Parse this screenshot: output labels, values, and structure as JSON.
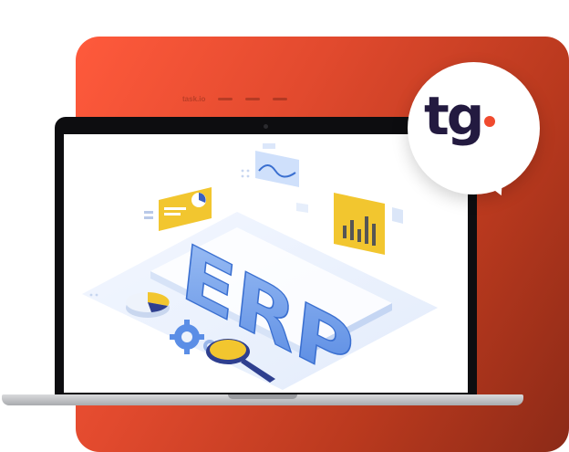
{
  "ghost_nav": {
    "brand": "task.io"
  },
  "logo": {
    "text": "tg",
    "dot_color": "#f04a2e",
    "text_color": "#231a40"
  },
  "illustration": {
    "word": "ERP"
  },
  "colors": {
    "panel": "#e24a2e",
    "accent_yellow": "#f2c62f",
    "accent_blue": "#5b8ee6"
  }
}
